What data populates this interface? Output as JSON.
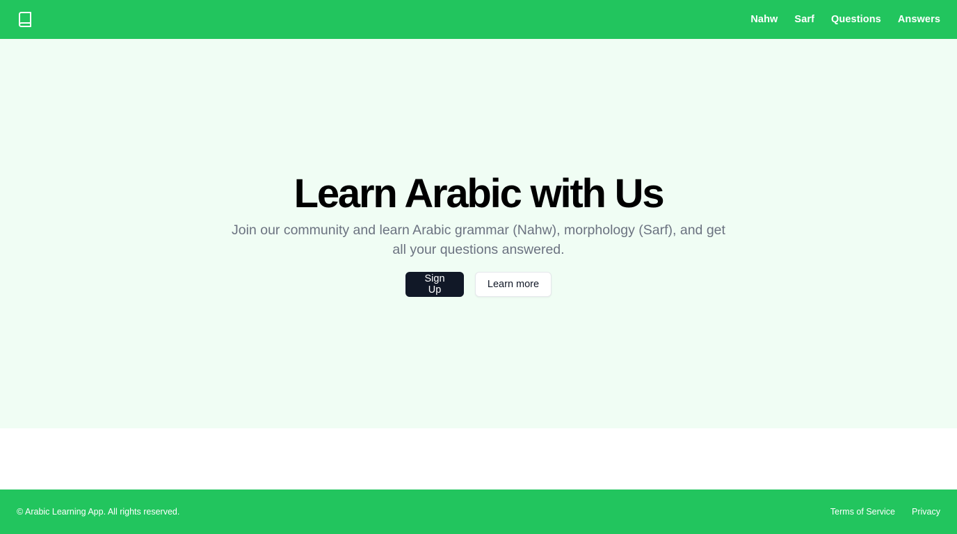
{
  "header": {
    "logo_icon": "book-icon",
    "nav": [
      {
        "label": "Nahw"
      },
      {
        "label": "Sarf"
      },
      {
        "label": "Questions"
      },
      {
        "label": "Answers"
      }
    ]
  },
  "hero": {
    "title": "Learn Arabic with Us",
    "subtitle": "Join our community and learn Arabic grammar (Nahw), morphology (Sarf), and get all your questions answered.",
    "primary_label": "Sign Up",
    "secondary_label": "Learn more"
  },
  "footer": {
    "copyright": "© Arabic Learning App. All rights reserved.",
    "links": [
      {
        "label": "Terms of Service"
      },
      {
        "label": "Privacy"
      }
    ]
  },
  "colors": {
    "brand_green": "#22c55e",
    "hero_bg": "#f0fdf4",
    "primary_button": "#111827",
    "muted_text": "#6b7280"
  }
}
